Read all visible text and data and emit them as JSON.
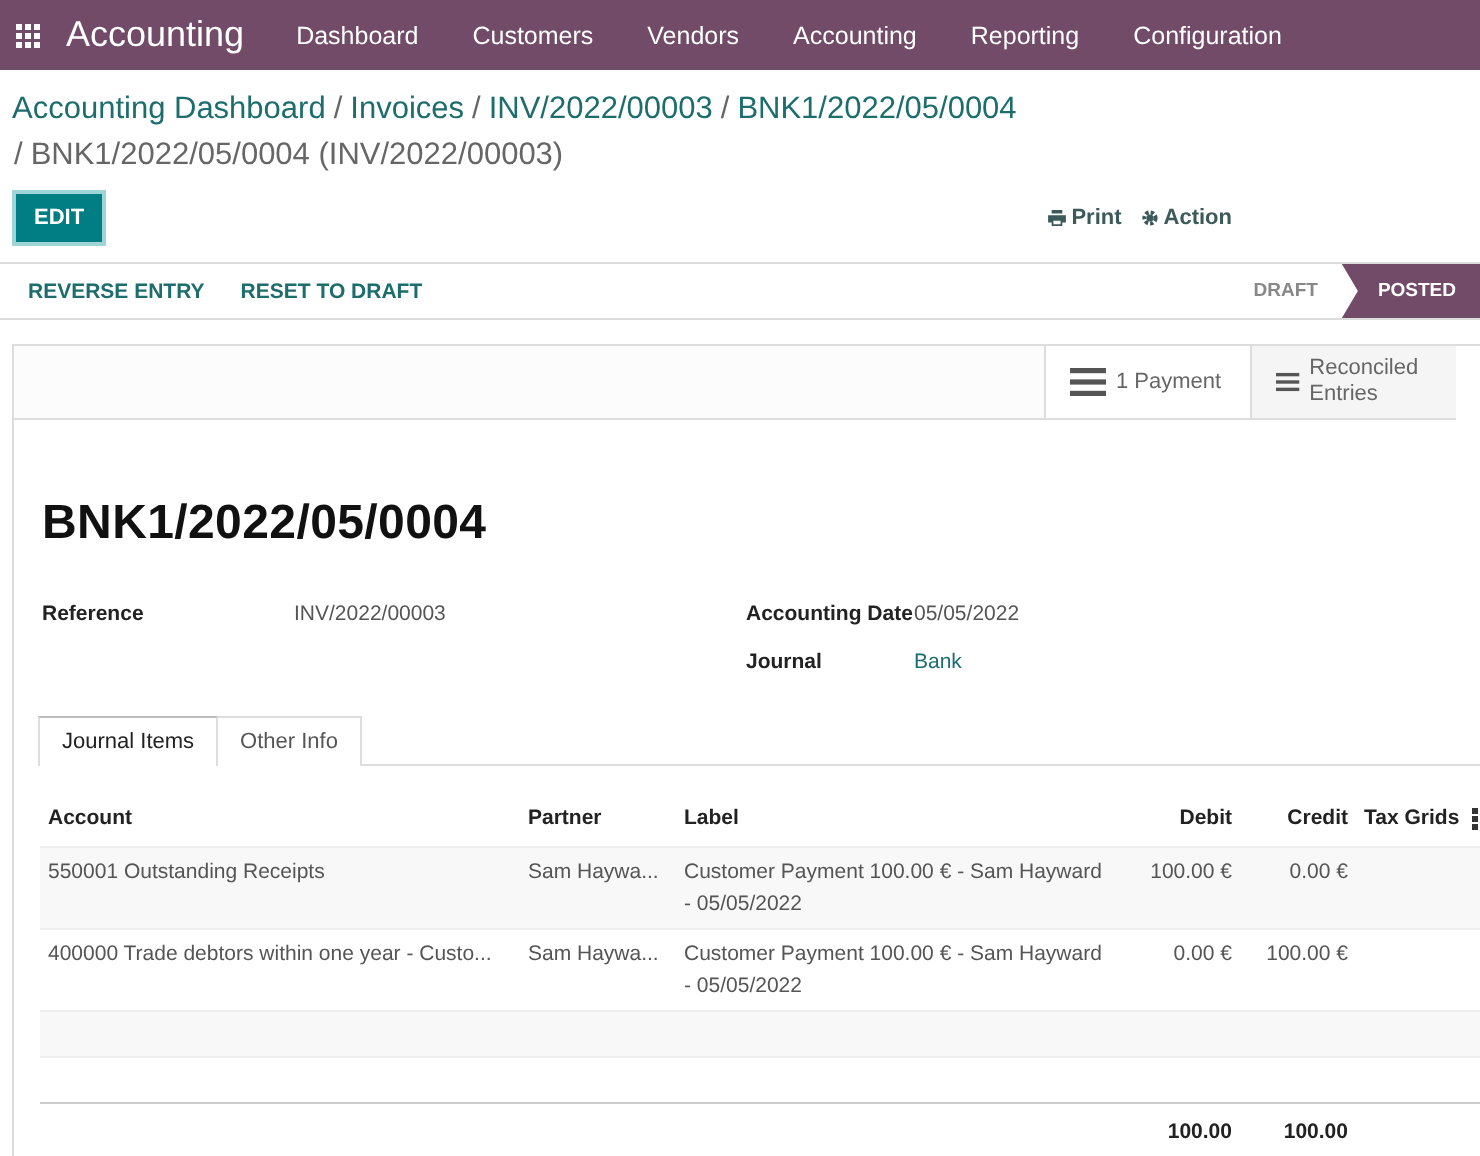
{
  "navbar": {
    "app_title": "Accounting",
    "menu": [
      "Dashboard",
      "Customers",
      "Vendors",
      "Accounting",
      "Reporting",
      "Configuration"
    ]
  },
  "breadcrumbs": {
    "separator": "/",
    "items": [
      {
        "label": "Accounting Dashboard",
        "current": false
      },
      {
        "label": "Invoices",
        "current": false
      },
      {
        "label": "INV/2022/00003",
        "current": false
      },
      {
        "label": "BNK1/2022/05/0004",
        "current": false
      },
      {
        "label": "BNK1/2022/05/0004 (INV/2022/00003)",
        "current": true
      }
    ]
  },
  "control_panel": {
    "edit_button": "EDIT",
    "print": "Print",
    "action": "Action"
  },
  "status_bar": {
    "buttons": [
      "REVERSE ENTRY",
      "RESET TO DRAFT"
    ],
    "stages": [
      {
        "label": "DRAFT",
        "selected": false
      },
      {
        "label": "POSTED",
        "selected": true
      }
    ]
  },
  "smart_buttons": [
    {
      "label": "1 Payment"
    },
    {
      "label": "Reconciled Entries"
    }
  ],
  "title": "BNK1/2022/05/0004",
  "fields_left": [
    {
      "label": "Reference",
      "value": "INV/2022/00003",
      "link": false
    }
  ],
  "fields_right": [
    {
      "label": "Accounting Date",
      "value": "05/05/2022",
      "link": false
    },
    {
      "label": "Journal",
      "value": "Bank",
      "link": true
    }
  ],
  "tabs": [
    {
      "label": "Journal Items",
      "selected": true
    },
    {
      "label": "Other Info",
      "selected": false
    }
  ],
  "table": {
    "columns": [
      {
        "label": "Account",
        "kind": "text"
      },
      {
        "label": "Partner",
        "kind": "text"
      },
      {
        "label": "Label",
        "kind": "text"
      },
      {
        "label": "Debit",
        "kind": "amount"
      },
      {
        "label": "Credit",
        "kind": "amount"
      },
      {
        "label": "Tax Grids",
        "kind": "text"
      }
    ],
    "rows": [
      [
        "550001 Outstanding Receipts",
        "Sam Haywa...",
        "Customer Payment 100.00 € - Sam Hayward - 05/05/2022",
        "100.00 €",
        "0.00 €",
        ""
      ],
      [
        "400000 Trade debtors within one year - Custo...",
        "Sam Haywa...",
        "Customer Payment 100.00 € - Sam Hayward - 05/05/2022",
        "0.00 €",
        "100.00 €",
        ""
      ]
    ],
    "totals": {
      "debit": "100.00",
      "credit": "100.00"
    }
  }
}
